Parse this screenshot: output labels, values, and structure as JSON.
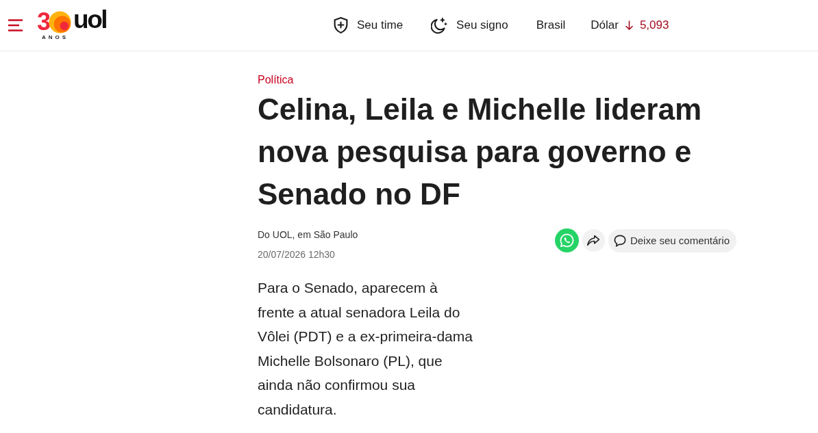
{
  "header": {
    "logo": {
      "number": "3",
      "brand": "uol",
      "caption": "ANOS"
    },
    "nav": [
      {
        "kind": "team",
        "label": "Seu time"
      },
      {
        "kind": "horoscope",
        "label": "Seu signo"
      },
      {
        "kind": "edition",
        "label": "Brasil"
      }
    ],
    "currency": {
      "label": "Dólar",
      "falling": true,
      "value": "5,093"
    }
  },
  "article": {
    "category": "Política",
    "headline": "Celina, Leila e Michelle lideram nova pesquisa para governo e Senado no DF",
    "byline": "Do UOL, em São Paulo",
    "date": "20/07/2026 12h30",
    "actions": [
      {
        "kind": "whatsapp"
      },
      {
        "kind": "share"
      },
      {
        "kind": "comment",
        "label": "Deixe seu comentário"
      }
    ],
    "lead": "Para o Senado, aparecem à frente a atual senadora Leila do Vôlei (PDT) e a ex-primeira-dama Michelle Bolsonaro (PL), que ainda não confirmou sua candidatura."
  }
}
